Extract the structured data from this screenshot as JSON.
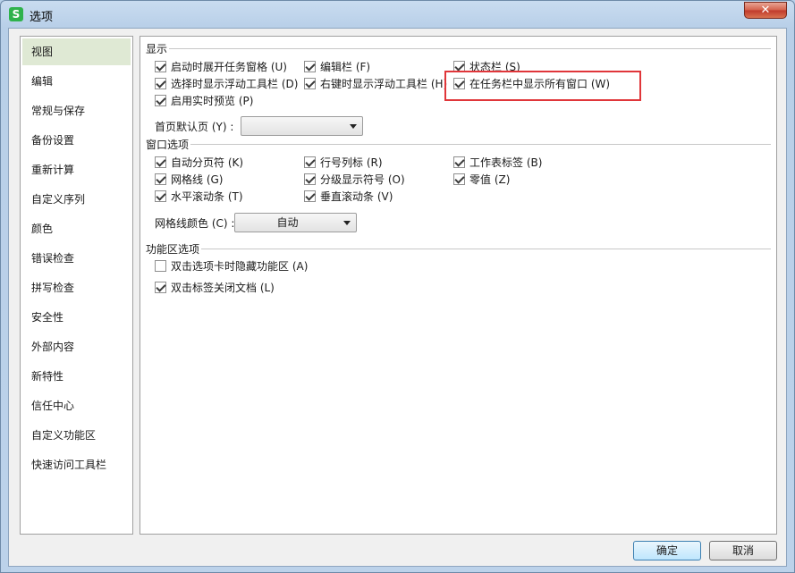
{
  "window": {
    "title": "选项",
    "app_icon_letter": "S",
    "close_symbol": "✕"
  },
  "sidebar": {
    "items": [
      {
        "label": "视图",
        "selected": true
      },
      {
        "label": "编辑"
      },
      {
        "label": "常规与保存"
      },
      {
        "label": "备份设置"
      },
      {
        "label": "重新计算"
      },
      {
        "label": "自定义序列"
      },
      {
        "label": "颜色"
      },
      {
        "label": "错误检查"
      },
      {
        "label": "拼写检查"
      },
      {
        "label": "安全性"
      },
      {
        "label": "外部内容"
      },
      {
        "label": "新特性"
      },
      {
        "label": "信任中心"
      },
      {
        "label": "自定义功能区"
      },
      {
        "label": "快速访问工具栏"
      }
    ]
  },
  "display": {
    "title": "显示",
    "options": [
      {
        "label": "启动时展开任务窗格 (U)",
        "checked": true
      },
      {
        "label": "编辑栏 (F)",
        "checked": true
      },
      {
        "label": "状态栏 (S)",
        "checked": true
      },
      {
        "label": "选择时显示浮动工具栏 (D)",
        "checked": true
      },
      {
        "label": "右键时显示浮动工具栏 (H)",
        "checked": true
      },
      {
        "label": "在任务栏中显示所有窗口 (W)",
        "checked": true
      },
      {
        "label": "启用实时预览 (P)",
        "checked": true
      }
    ],
    "home_page_label": "首页默认页 (Y) :",
    "home_page_value": ""
  },
  "window_options": {
    "title": "窗口选项",
    "options": [
      {
        "label": "自动分页符 (K)",
        "checked": true
      },
      {
        "label": "行号列标 (R)",
        "checked": true
      },
      {
        "label": "工作表标签 (B)",
        "checked": true
      },
      {
        "label": "网格线 (G)",
        "checked": true
      },
      {
        "label": "分级显示符号 (O)",
        "checked": true
      },
      {
        "label": "零值 (Z)",
        "checked": true
      },
      {
        "label": "水平滚动条 (T)",
        "checked": true
      },
      {
        "label": "垂直滚动条 (V)",
        "checked": true
      }
    ],
    "gridline_color_label": "网格线颜色 (C) :",
    "gridline_color_value": "自动"
  },
  "ribbon": {
    "title": "功能区选项",
    "options": [
      {
        "label": "双击选项卡时隐藏功能区 (A)",
        "checked": false
      },
      {
        "label": "双击标签关闭文档 (L)",
        "checked": true
      }
    ]
  },
  "buttons": {
    "ok": "确定",
    "cancel": "取消"
  },
  "colors": {
    "highlight": "#e0363a",
    "selected_bg": "#dfe9d4"
  }
}
